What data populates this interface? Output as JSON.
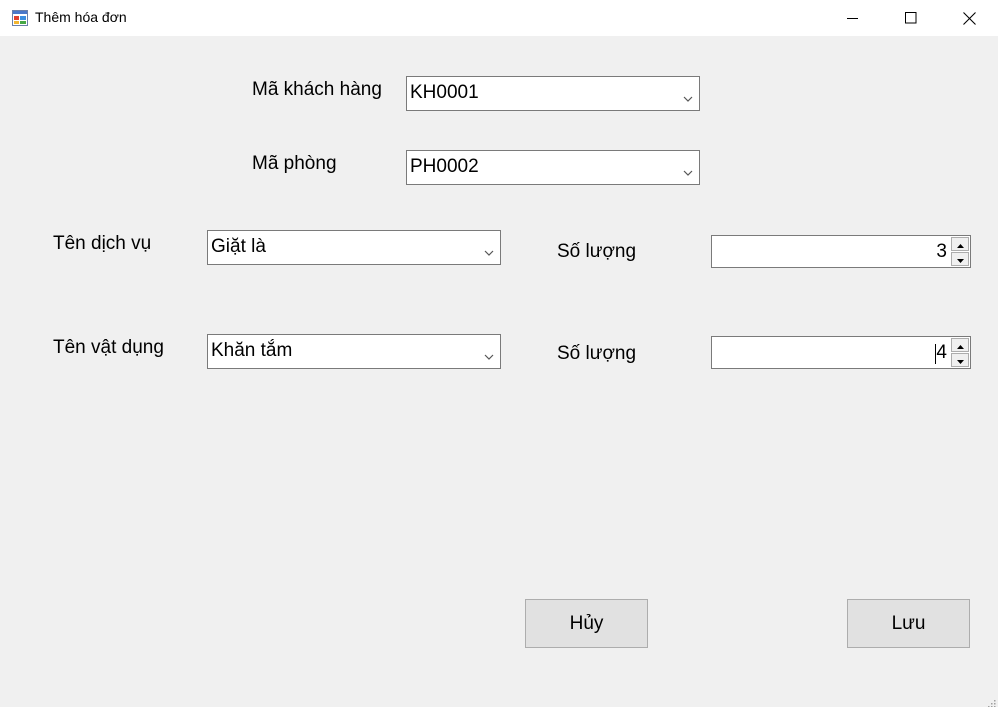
{
  "window": {
    "title": "Thêm hóa đơn",
    "app_icon": "windows-form-icon",
    "controls": {
      "minimize": "minimize-icon",
      "maximize": "maximize-icon",
      "close": "close-icon"
    }
  },
  "form": {
    "customer": {
      "label": "Mã khách hàng",
      "value": "KH0001"
    },
    "room": {
      "label": "Mã phòng",
      "value": "PH0002"
    },
    "service": {
      "label": "Tên dịch vụ",
      "value": "Giặt là",
      "quantity_label": "Số lượng",
      "quantity": "3"
    },
    "item": {
      "label": "Tên vật dụng",
      "value": "Khăn tắm",
      "quantity_label": "Số lượng",
      "quantity": "4"
    }
  },
  "buttons": {
    "cancel": "Hủy",
    "save": "Lưu"
  },
  "colors": {
    "background": "#f0f0f0",
    "titlebar": "#ffffff",
    "input_border": "#7a7a7a",
    "button_face": "#e1e1e1",
    "button_border": "#adadad"
  }
}
